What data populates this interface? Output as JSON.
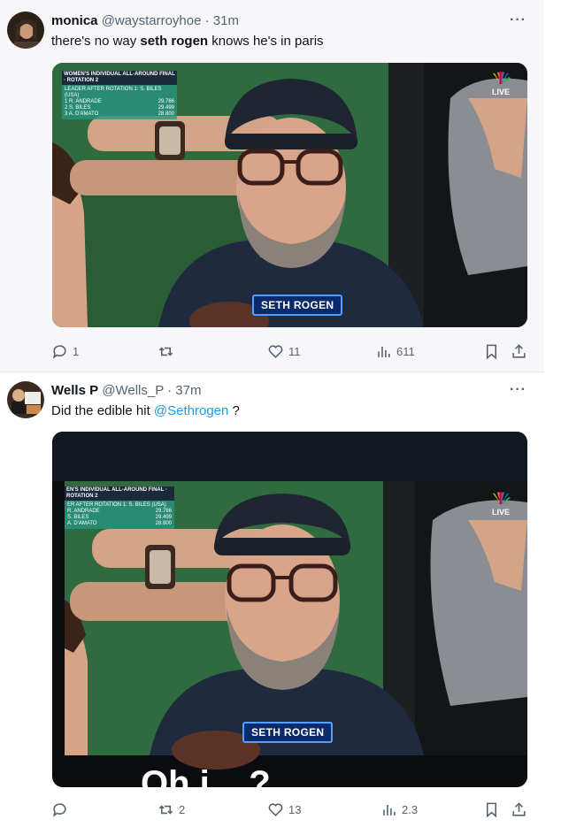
{
  "tweets": [
    {
      "display_name": "monica",
      "handle": "@waystarroyhoe",
      "time": " · 31m",
      "text_before": "there's no way ",
      "text_bold": "seth rogen",
      "text_after": " knows he's in paris",
      "media": {
        "scoreboard_title": "WOMEN'S INDIVIDUAL ALL-AROUND FINAL · ROTATION 2",
        "scoreboard_sub": "LEADER AFTER ROTATION 1: S. BILES (USA)",
        "rows": [
          {
            "rank": "1",
            "name": "R. ANDRADE",
            "score": "29.766"
          },
          {
            "rank": "2",
            "name": "S. BILES",
            "score": "29.499"
          },
          {
            "rank": "3",
            "name": "A. D'AMATO",
            "score": "28.800"
          }
        ],
        "caption": "SETH ROGEN",
        "live": "LIVE"
      },
      "actions": {
        "replies": "1",
        "retweets": "",
        "likes": "11",
        "views": "611"
      }
    },
    {
      "display_name": "Wells P",
      "handle": "@Wells_P",
      "time": " · 37m",
      "text_before": "Did the edible hit ",
      "mention": "@Sethrogen",
      "text_after": " ?",
      "media": {
        "scoreboard_title": "EN'S INDIVIDUAL ALL-AROUND FINAL · ROTATION 2",
        "scoreboard_sub": "ER AFTER ROTATION 1: S. BILES (USA)",
        "rows": [
          {
            "rank": "",
            "name": "R. ANDRADE",
            "score": "29.766"
          },
          {
            "rank": "",
            "name": "S. BILES",
            "score": "29.499"
          },
          {
            "rank": "",
            "name": "A. D'AMATO",
            "score": "28.800"
          }
        ],
        "caption": "SETH ROGEN",
        "live": "LIVE",
        "bottom_text": "Oh i... ?"
      },
      "actions": {
        "replies": "",
        "retweets": "2",
        "likes": "13",
        "views": "2.3"
      }
    }
  ],
  "colors": {
    "text": "#0f1419",
    "muted": "#536471",
    "link": "#1d9bf0"
  }
}
